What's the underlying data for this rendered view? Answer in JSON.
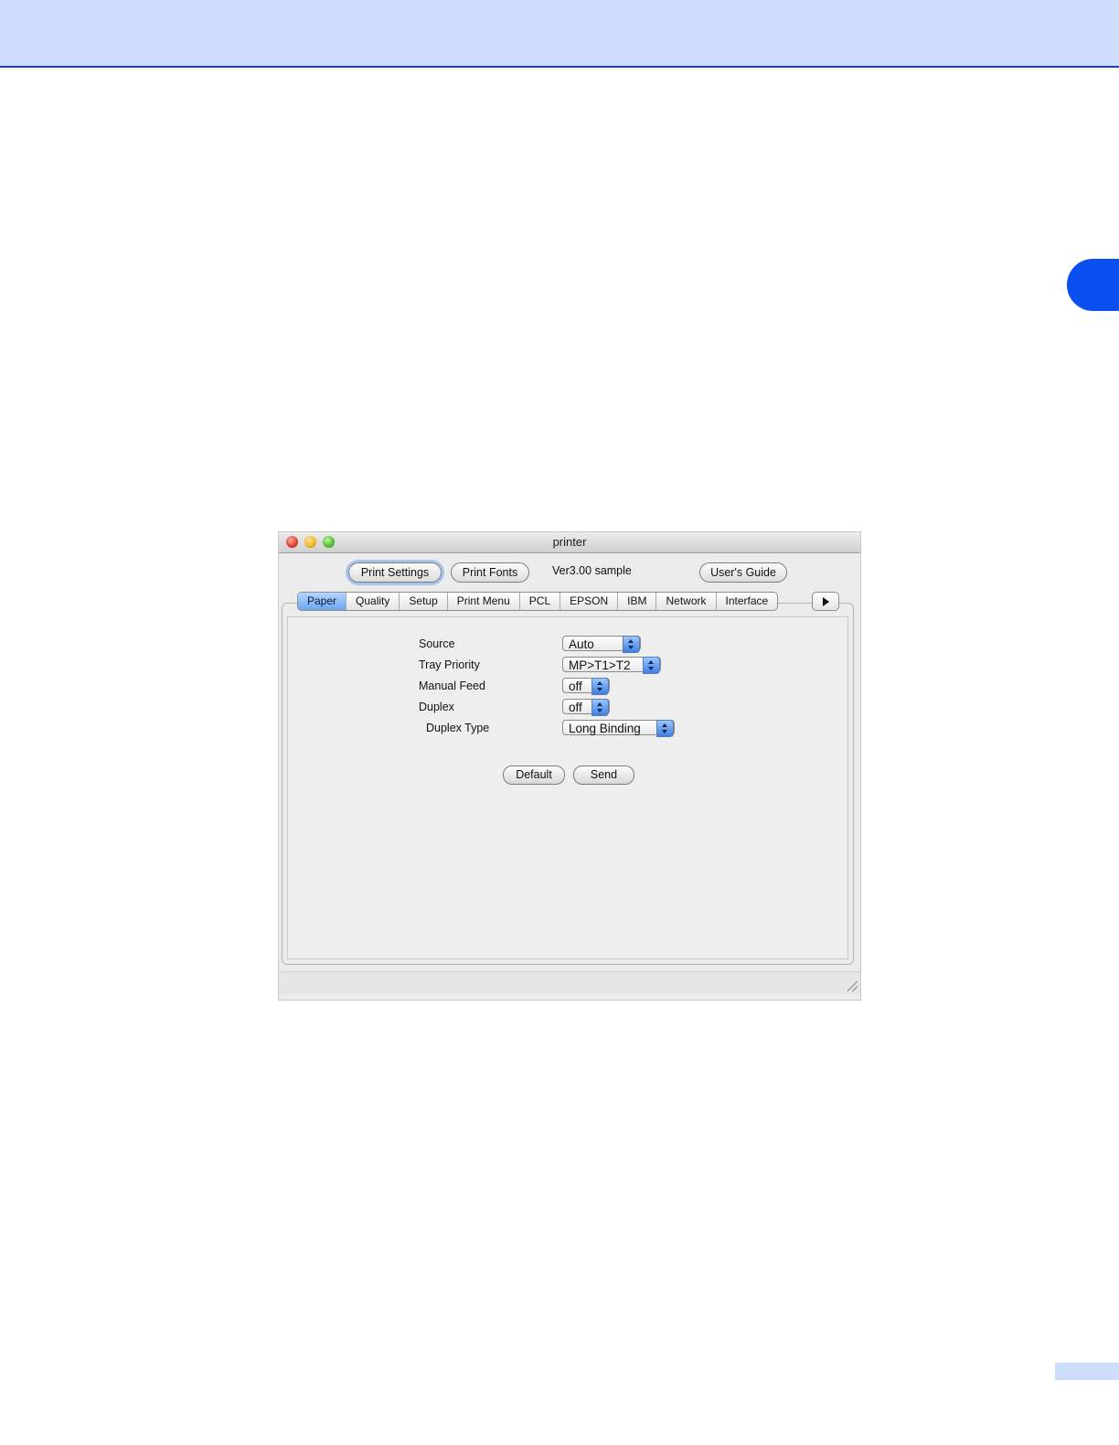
{
  "window": {
    "title": "printer"
  },
  "toolbar": {
    "print_settings_label": "Print Settings",
    "print_fonts_label": "Print Fonts",
    "version_text": "Ver3.00 sample",
    "users_guide_label": "User's Guide"
  },
  "tabs": [
    {
      "label": "Paper",
      "active": true
    },
    {
      "label": "Quality",
      "active": false
    },
    {
      "label": "Setup",
      "active": false
    },
    {
      "label": "Print Menu",
      "active": false
    },
    {
      "label": "PCL",
      "active": false
    },
    {
      "label": "EPSON",
      "active": false
    },
    {
      "label": "IBM",
      "active": false
    },
    {
      "label": "Network",
      "active": false
    },
    {
      "label": "Interface",
      "active": false
    }
  ],
  "fields": {
    "source": {
      "label": "Source",
      "value": "Auto"
    },
    "tray_priority": {
      "label": "Tray Priority",
      "value": "MP>T1>T2"
    },
    "manual_feed": {
      "label": "Manual Feed",
      "value": "off"
    },
    "duplex": {
      "label": "Duplex",
      "value": "off"
    },
    "duplex_type": {
      "label": "Duplex Type",
      "value": "Long Binding"
    }
  },
  "actions": {
    "default_label": "Default",
    "send_label": "Send"
  },
  "colors": {
    "header_band": "#ccdcfb",
    "chapter_tab": "#0a4ff0",
    "active_tab": "#6ba6f0",
    "popup_arrows": "#3f7fe0"
  },
  "icons": [
    "close-window-icon",
    "minimize-window-icon",
    "zoom-window-icon",
    "tab-scroll-right-icon",
    "resize-grip-icon"
  ]
}
